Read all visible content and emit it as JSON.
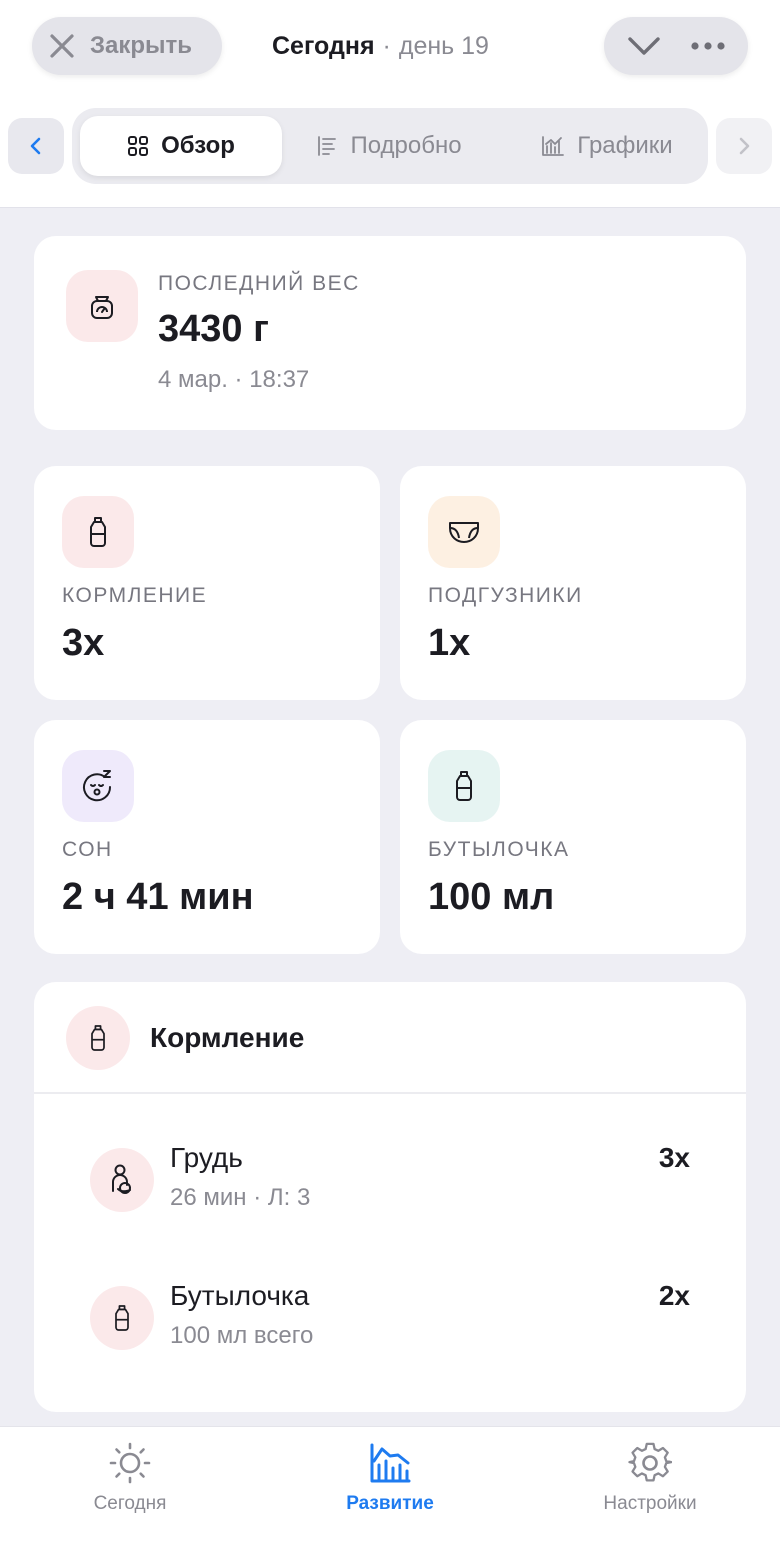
{
  "header": {
    "close_label": "Закрыть",
    "title": "Сегодня",
    "separator": "·",
    "day": "день 19"
  },
  "segments": [
    {
      "label": "Обзор",
      "icon": "grid-icon",
      "active": true
    },
    {
      "label": "Подробно",
      "icon": "list-icon",
      "active": false
    },
    {
      "label": "Графики",
      "icon": "chart-icon",
      "active": false
    }
  ],
  "weight": {
    "label": "ПОСЛЕДНИЙ ВЕС",
    "value": "3430 г",
    "time": "4 мар. · 18:37",
    "icon": "scale-icon"
  },
  "stats": [
    {
      "label": "КОРМЛЕНИЕ",
      "value": "3x",
      "icon": "bottle-icon",
      "bg": "#fbe9ea"
    },
    {
      "label": "ПОДГУЗНИКИ",
      "value": "1x",
      "icon": "diaper-icon",
      "bg": "#fdf0e2"
    },
    {
      "label": "СОН",
      "value": "2 ч 41 мин",
      "icon": "sleep-face-icon",
      "bg": "#efeafb"
    },
    {
      "label": "БУТЫЛОЧКА",
      "value": "100 мл",
      "icon": "bottle-icon",
      "bg": "#e6f4f2"
    }
  ],
  "feeding": {
    "title": "Кормление",
    "rows": [
      {
        "name": "Грудь",
        "sub": "26 мин · Л: 3",
        "count": "3x",
        "icon": "breastfeeding-icon"
      },
      {
        "name": "Бутылочка",
        "sub": "100 мл всего",
        "count": "2x",
        "icon": "bottle-icon"
      }
    ]
  },
  "tabbar": [
    {
      "label": "Сегодня",
      "icon": "sun-icon",
      "active": false
    },
    {
      "label": "Развитие",
      "icon": "growth-chart-icon",
      "active": true
    },
    {
      "label": "Настройки",
      "icon": "gear-icon",
      "active": false
    }
  ],
  "colors": {
    "accent": "#1e7bf0",
    "muted": "#8a8a92",
    "background": "#eeeef4"
  }
}
